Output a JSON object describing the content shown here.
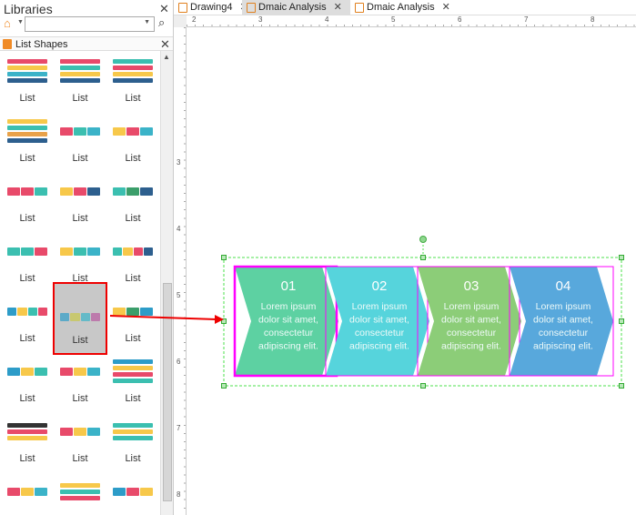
{
  "libraries": {
    "title": "Libraries",
    "search_placeholder": "",
    "section_title": "List Shapes",
    "items": [
      {
        "label": "List",
        "colors": [
          "#e84a6a",
          "#f7c84a",
          "#3bb3c8",
          "#2d5f8e"
        ]
      },
      {
        "label": "List",
        "colors": [
          "#e84a6a",
          "#3bbfb0",
          "#f7c84a",
          "#2d5f8e"
        ]
      },
      {
        "label": "List",
        "colors": [
          "#3bbfb0",
          "#e84a6a",
          "#f7c84a",
          "#2d5f8e"
        ]
      },
      {
        "label": "List",
        "colors": [
          "#f7c84a",
          "#3bbfb0",
          "#e8a24a",
          "#2d5f8e"
        ]
      },
      {
        "label": "List",
        "colors": [
          "#e84a6a",
          "#3bbfb0",
          "#3bb3c8"
        ],
        "row": true
      },
      {
        "label": "List",
        "colors": [
          "#f7c84a",
          "#e84a6a",
          "#3bb3c8"
        ],
        "row": true
      },
      {
        "label": "List",
        "colors": [
          "#e84a6a",
          "#e84a6a",
          "#3bbfb0"
        ],
        "row": true
      },
      {
        "label": "List",
        "colors": [
          "#f7c84a",
          "#e84a6a",
          "#2d5f8e"
        ],
        "row": true
      },
      {
        "label": "List",
        "colors": [
          "#3bbfb0",
          "#3b9e6a",
          "#2d5f8e"
        ],
        "row": true
      },
      {
        "label": "List",
        "colors": [
          "#3bbfb0",
          "#3bbfb0",
          "#e84a6a"
        ],
        "row": true
      },
      {
        "label": "List",
        "colors": [
          "#f7c84a",
          "#3bbfb0",
          "#3bb3c8"
        ],
        "row": true
      },
      {
        "label": "List",
        "colors": [
          "#3bbfb0",
          "#f7c84a",
          "#e84a6a",
          "#2d5f8e"
        ],
        "row": true
      },
      {
        "label": "List",
        "colors": [
          "#2d9cc8",
          "#f7c84a",
          "#3bbfb0",
          "#e84a6a"
        ],
        "row": true
      },
      {
        "label": "List",
        "colors": [
          "#2d9cc8",
          "#c8c84a",
          "#3bb3c8",
          "#b85aa0"
        ],
        "row": true,
        "selected": true
      },
      {
        "label": "List",
        "colors": [
          "#f7c84a",
          "#3b9e6a",
          "#2d9cc8"
        ],
        "row": true
      },
      {
        "label": "List",
        "colors": [
          "#2d9cc8",
          "#f7c84a",
          "#3bbfb0"
        ],
        "row": true
      },
      {
        "label": "List",
        "colors": [
          "#e84a6a",
          "#f7c84a",
          "#3bb3c8"
        ],
        "row": true
      },
      {
        "label": "List",
        "colors": [
          "#2d9cc8",
          "#f7c84a",
          "#e84a6a",
          "#3bbfb0"
        ]
      },
      {
        "label": "List",
        "colors": [
          "#333",
          "#e84a6a",
          "#f7c84a"
        ]
      },
      {
        "label": "List",
        "colors": [
          "#e84a6a",
          "#f7c84a",
          "#3bb3c8"
        ],
        "row": true
      },
      {
        "label": "List",
        "colors": [
          "#3bbfb0",
          "#f7c84a",
          "#3bbfb0"
        ]
      },
      {
        "label": "",
        "colors": [
          "#e84a6a",
          "#f7c84a",
          "#3bb3c8"
        ],
        "row": true
      },
      {
        "label": "",
        "colors": [
          "#f7c84a",
          "#3bbfb0",
          "#e84a6a"
        ]
      },
      {
        "label": "",
        "colors": [
          "#2d9cc8",
          "#e84a6a",
          "#f7c84a"
        ],
        "row": true
      }
    ]
  },
  "tabs": [
    {
      "label": "Drawing4",
      "active": false
    },
    {
      "label": "Dmaic Analysis",
      "active": true
    },
    {
      "label": "Dmaic Analysis",
      "active": false
    }
  ],
  "ruler": {
    "h": [
      "2",
      "3",
      "4",
      "5",
      "6",
      "7",
      "8"
    ],
    "v": [
      "3",
      "4",
      "5",
      "6",
      "7",
      "8"
    ]
  },
  "diagram": {
    "steps": [
      {
        "number": "01",
        "lines": [
          "Lorem ipsum",
          "dolor sit amet,",
          "consectetur",
          "adipiscing elit."
        ],
        "color": "#5dd1a2"
      },
      {
        "number": "02",
        "lines": [
          "Lorem ipsum",
          "dolor sit amet,",
          "consectetur",
          "adipiscing elit."
        ],
        "color": "#56d4dc"
      },
      {
        "number": "03",
        "lines": [
          "Lorem ipsum",
          "dolor sit amet,",
          "consectetur",
          "adipiscing elit."
        ],
        "color": "#8ccd78"
      },
      {
        "number": "04",
        "lines": [
          "Lorem ipsum",
          "dolor sit amet,",
          "consectetur",
          "adipiscing elit."
        ],
        "color": "#58a8dc"
      }
    ]
  }
}
